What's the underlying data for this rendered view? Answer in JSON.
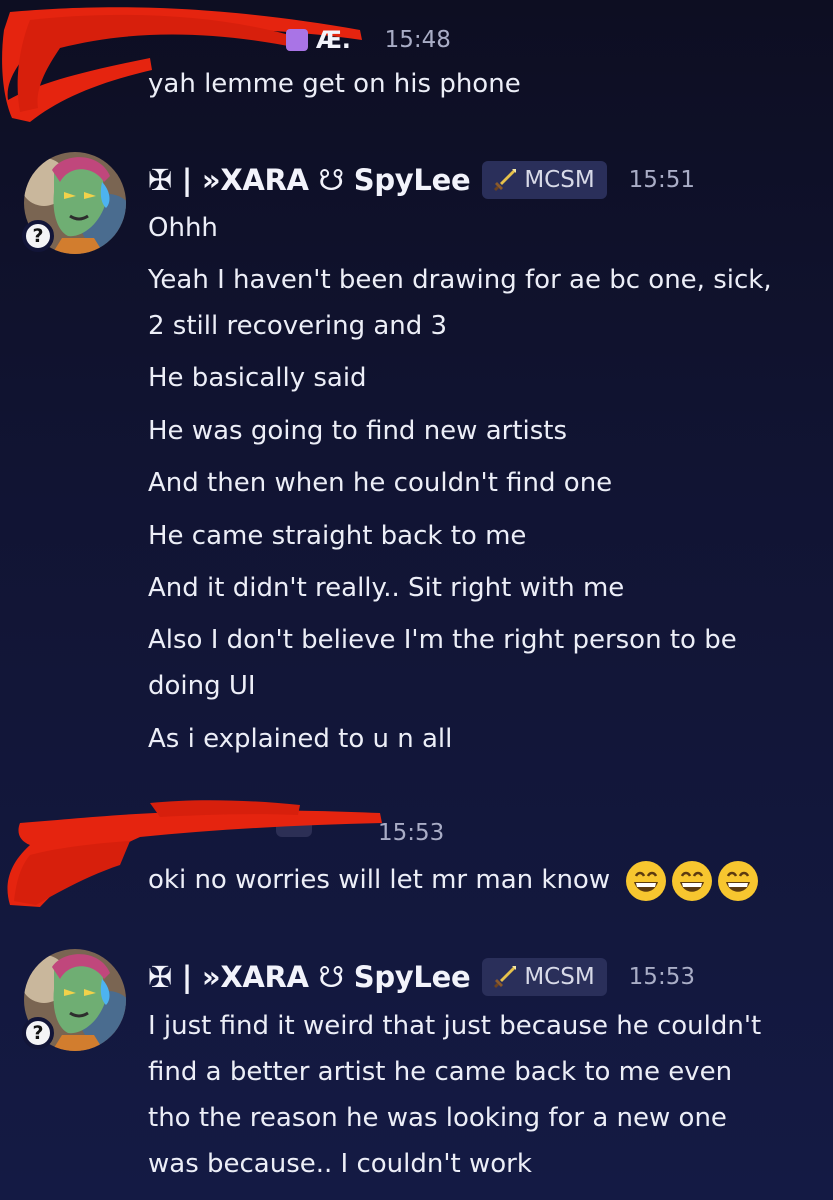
{
  "messages": [
    {
      "timestamp": "15:48",
      "username_fragment": "Æ.",
      "lines": [
        "yah lemme get on his phone"
      ]
    },
    {
      "username": "✠ | »XARA ☋ SpyLee",
      "tag": "MCSM",
      "timestamp": "15:51",
      "lines": [
        "Ohhh",
        "Yeah I haven't been drawing for ae bc one, sick,",
        "2 still recovering and 3",
        "He basically said",
        "He was going to find new artists",
        "And then when he couldn't find one",
        "He came straight back to me",
        "And it didn't really.. Sit right with me",
        "Also I don't believe I'm the right person to be",
        "doing UI",
        "As i explained to u n all"
      ]
    },
    {
      "timestamp": "15:53",
      "lines": [
        "oki no worries will let mr man know"
      ],
      "emojis": [
        "grinning-face",
        "grinning-face",
        "grinning-face"
      ]
    },
    {
      "username": "✠ | »XARA ☋ SpyLee",
      "tag": "MCSM",
      "timestamp": "15:53",
      "lines": [
        "I just find it weird that just because he couldn't",
        "find a better artist he came back to me even",
        "tho the reason he was looking for a new one",
        "was because.. I couldn't work"
      ]
    }
  ],
  "colors": {
    "background_top": "#0d0e22",
    "background_bottom": "#141a44",
    "redaction": "#e5240f",
    "tag_bg": "#2a2f5a",
    "timestamp": "#a9adc6"
  },
  "icons": {
    "help": "?",
    "tag_icon": "sword-icon"
  }
}
